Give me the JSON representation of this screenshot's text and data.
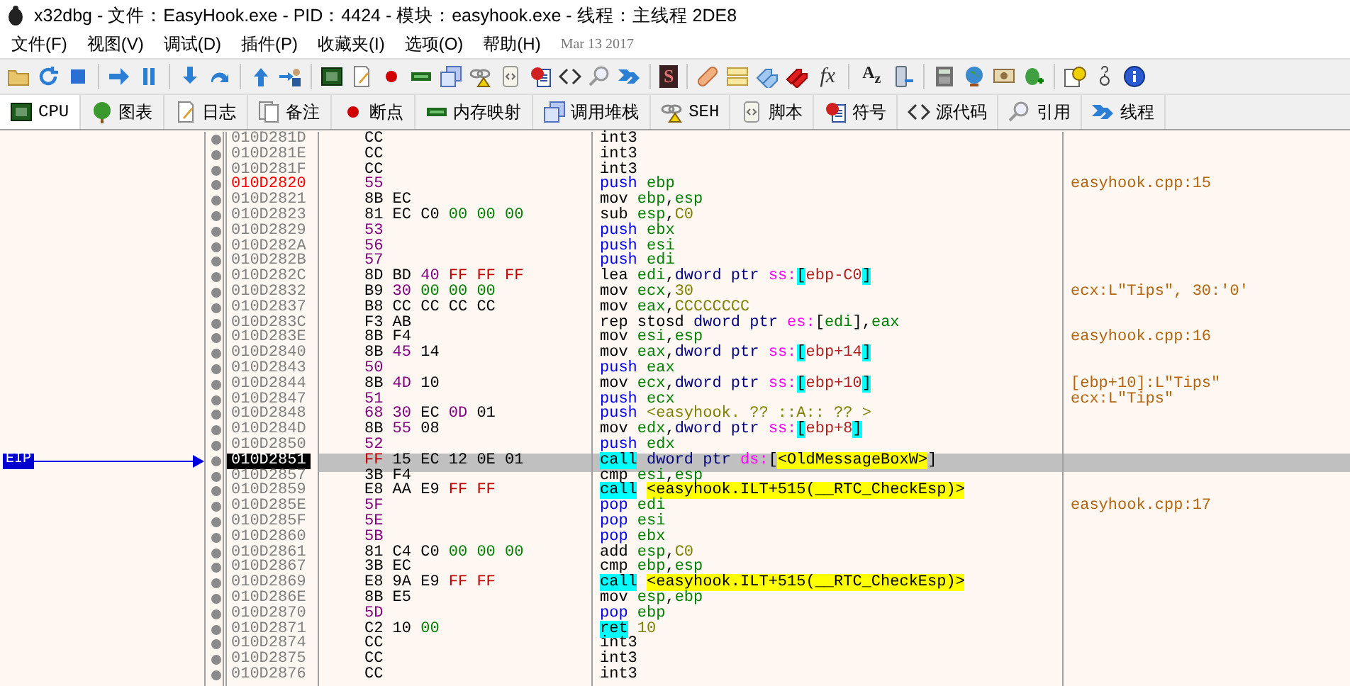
{
  "window": {
    "title": "x32dbg - 文件：EasyHook.exe - PID：4424 - 模块：easyhook.exe - 线程：主线程 2DE8"
  },
  "menu": [
    "文件(F)",
    "视图(V)",
    "调试(D)",
    "插件(P)",
    "收藏夹(I)",
    "选项(O)",
    "帮助(H)"
  ],
  "build_date": "Mar 13 2017",
  "toolbar_labels": [
    "S",
    "fx",
    "A$_{z}$"
  ],
  "tabs": [
    {
      "label": "CPU",
      "selected": true
    },
    {
      "label": "图表",
      "selected": false
    },
    {
      "label": "日志",
      "selected": false
    },
    {
      "label": "备注",
      "selected": false
    },
    {
      "label": "断点",
      "selected": false
    },
    {
      "label": "内存映射",
      "selected": false
    },
    {
      "label": "调用堆栈",
      "selected": false
    },
    {
      "label": "SEH",
      "selected": false
    },
    {
      "label": "脚本",
      "selected": false
    },
    {
      "label": "符号",
      "selected": false
    },
    {
      "label": "源代码",
      "selected": false
    },
    {
      "label": "引用",
      "selected": false
    },
    {
      "label": "线程",
      "selected": false
    }
  ],
  "eip_label": "EIP",
  "rows": [
    {
      "address": "010D281D",
      "kind": "normal",
      "selected": false,
      "bytes": [
        {
          "kind": "k",
          "text": "CC"
        }
      ],
      "instr": [
        {
          "kind": "m",
          "text": "int3"
        }
      ]
    },
    {
      "address": "010D281E",
      "kind": "normal",
      "selected": false,
      "bytes": [
        {
          "kind": "k",
          "text": "CC"
        }
      ],
      "instr": [
        {
          "kind": "m",
          "text": "int3"
        }
      ]
    },
    {
      "address": "010D281F",
      "kind": "normal",
      "selected": false,
      "bytes": [
        {
          "kind": "k",
          "text": "CC"
        }
      ],
      "instr": [
        {
          "kind": "m",
          "text": "int3"
        }
      ]
    },
    {
      "address": "010D2820",
      "kind": "function",
      "selected": false,
      "bytes": [
        {
          "kind": "p",
          "text": "55"
        }
      ],
      "instr": [
        {
          "kind": "mp",
          "text": "push"
        },
        {
          "kind": "r",
          "text": "ebp"
        }
      ],
      "comment": "easyhook.cpp:15"
    },
    {
      "address": "010D2821",
      "kind": "normal",
      "selected": false,
      "bytes": [
        {
          "kind": "k",
          "text": "8B"
        },
        {
          "kind": "k",
          "text": "EC"
        }
      ],
      "instr": [
        {
          "kind": "m",
          "text": "mov"
        },
        {
          "kind": "r",
          "text": "ebp"
        },
        {
          "kind": "t",
          "text": ","
        },
        {
          "kind": "r",
          "text": "esp"
        }
      ]
    },
    {
      "address": "010D2823",
      "kind": "normal",
      "selected": false,
      "bytes": [
        {
          "kind": "k",
          "text": "81"
        },
        {
          "kind": "k",
          "text": "EC"
        },
        {
          "kind": "k",
          "text": "C0"
        },
        {
          "kind": "g",
          "text": "00"
        },
        {
          "kind": "g",
          "text": "00"
        },
        {
          "kind": "g",
          "text": "00"
        }
      ],
      "instr": [
        {
          "kind": "m",
          "text": "sub"
        },
        {
          "kind": "r",
          "text": "esp"
        },
        {
          "kind": "t",
          "text": ","
        },
        {
          "kind": "n",
          "text": "C0"
        }
      ]
    },
    {
      "address": "010D2829",
      "kind": "normal",
      "selected": false,
      "bytes": [
        {
          "kind": "p",
          "text": "53"
        }
      ],
      "instr": [
        {
          "kind": "mp",
          "text": "push"
        },
        {
          "kind": "r",
          "text": "ebx"
        }
      ]
    },
    {
      "address": "010D282A",
      "kind": "normal",
      "selected": false,
      "bytes": [
        {
          "kind": "p",
          "text": "56"
        }
      ],
      "instr": [
        {
          "kind": "mp",
          "text": "push"
        },
        {
          "kind": "r",
          "text": "esi"
        }
      ]
    },
    {
      "address": "010D282B",
      "kind": "normal",
      "selected": false,
      "bytes": [
        {
          "kind": "p",
          "text": "57"
        }
      ],
      "instr": [
        {
          "kind": "mp",
          "text": "push"
        },
        {
          "kind": "r",
          "text": "edi"
        }
      ]
    },
    {
      "address": "010D282C",
      "kind": "normal",
      "selected": false,
      "bytes": [
        {
          "kind": "k",
          "text": "8D"
        },
        {
          "kind": "k",
          "text": "BD"
        },
        {
          "kind": "p",
          "text": "40"
        },
        {
          "kind": "d",
          "text": "FF"
        },
        {
          "kind": "d",
          "text": "FF"
        },
        {
          "kind": "d",
          "text": "FF"
        }
      ],
      "instr": [
        {
          "kind": "m",
          "text": "lea"
        },
        {
          "kind": "r",
          "text": "edi"
        },
        {
          "kind": "t",
          "text": ","
        },
        {
          "kind": "q",
          "text": "dword ptr"
        },
        {
          "kind": "s",
          "text": "ss:"
        },
        {
          "kind": "b",
          "text": "["
        },
        {
          "kind": "a",
          "text": "ebp-C0"
        },
        {
          "kind": "b",
          "text": "]"
        }
      ]
    },
    {
      "address": "010D2832",
      "kind": "normal",
      "selected": false,
      "bytes": [
        {
          "kind": "k",
          "text": "B9"
        },
        {
          "kind": "p",
          "text": "30"
        },
        {
          "kind": "g",
          "text": "00"
        },
        {
          "kind": "g",
          "text": "00"
        },
        {
          "kind": "g",
          "text": "00"
        }
      ],
      "instr": [
        {
          "kind": "m",
          "text": "mov"
        },
        {
          "kind": "r",
          "text": "ecx"
        },
        {
          "kind": "t",
          "text": ","
        },
        {
          "kind": "n",
          "text": "30"
        }
      ],
      "comment": "ecx:L\"Tips\", 30:'0'"
    },
    {
      "address": "010D2837",
      "kind": "normal",
      "selected": false,
      "bytes": [
        {
          "kind": "k",
          "text": "B8"
        },
        {
          "kind": "k",
          "text": "CC"
        },
        {
          "kind": "k",
          "text": "CC"
        },
        {
          "kind": "k",
          "text": "CC"
        },
        {
          "kind": "k",
          "text": "CC"
        }
      ],
      "instr": [
        {
          "kind": "m",
          "text": "mov"
        },
        {
          "kind": "r",
          "text": "eax"
        },
        {
          "kind": "t",
          "text": ","
        },
        {
          "kind": "n",
          "text": "CCCCCCCC"
        }
      ]
    },
    {
      "address": "010D283C",
      "kind": "normal",
      "selected": false,
      "bytes": [
        {
          "kind": "k",
          "text": "F3"
        },
        {
          "kind": "k",
          "text": "AB"
        }
      ],
      "instr": [
        {
          "kind": "m",
          "text": "rep stosd"
        },
        {
          "kind": "q",
          "text": "dword ptr"
        },
        {
          "kind": "s",
          "text": "es:"
        },
        {
          "kind": "t",
          "text": "["
        },
        {
          "kind": "r",
          "text": "edi"
        },
        {
          "kind": "t",
          "text": "],"
        },
        {
          "kind": "r",
          "text": "eax"
        }
      ]
    },
    {
      "address": "010D283E",
      "kind": "normal",
      "selected": false,
      "bytes": [
        {
          "kind": "k",
          "text": "8B"
        },
        {
          "kind": "k",
          "text": "F4"
        }
      ],
      "instr": [
        {
          "kind": "m",
          "text": "mov"
        },
        {
          "kind": "r",
          "text": "esi"
        },
        {
          "kind": "t",
          "text": ","
        },
        {
          "kind": "r",
          "text": "esp"
        }
      ],
      "comment": "easyhook.cpp:16"
    },
    {
      "address": "010D2840",
      "kind": "normal",
      "selected": false,
      "bytes": [
        {
          "kind": "k",
          "text": "8B"
        },
        {
          "kind": "p",
          "text": "45"
        },
        {
          "kind": "k",
          "text": "14"
        }
      ],
      "instr": [
        {
          "kind": "m",
          "text": "mov"
        },
        {
          "kind": "r",
          "text": "eax"
        },
        {
          "kind": "t",
          "text": ","
        },
        {
          "kind": "q",
          "text": "dword ptr"
        },
        {
          "kind": "s",
          "text": "ss:"
        },
        {
          "kind": "b",
          "text": "["
        },
        {
          "kind": "a",
          "text": "ebp+14"
        },
        {
          "kind": "b",
          "text": "]"
        }
      ]
    },
    {
      "address": "010D2843",
      "kind": "normal",
      "selected": false,
      "bytes": [
        {
          "kind": "p",
          "text": "50"
        }
      ],
      "instr": [
        {
          "kind": "mp",
          "text": "push"
        },
        {
          "kind": "r",
          "text": "eax"
        }
      ]
    },
    {
      "address": "010D2844",
      "kind": "normal",
      "selected": false,
      "bytes": [
        {
          "kind": "k",
          "text": "8B"
        },
        {
          "kind": "p",
          "text": "4D"
        },
        {
          "kind": "k",
          "text": "10"
        }
      ],
      "instr": [
        {
          "kind": "m",
          "text": "mov"
        },
        {
          "kind": "r",
          "text": "ecx"
        },
        {
          "kind": "t",
          "text": ","
        },
        {
          "kind": "q",
          "text": "dword ptr"
        },
        {
          "kind": "s",
          "text": "ss:"
        },
        {
          "kind": "b",
          "text": "["
        },
        {
          "kind": "a",
          "text": "ebp+10"
        },
        {
          "kind": "b",
          "text": "]"
        }
      ],
      "comment": "[ebp+10]:L\"Tips\""
    },
    {
      "address": "010D2847",
      "kind": "normal",
      "selected": false,
      "bytes": [
        {
          "kind": "p",
          "text": "51"
        }
      ],
      "instr": [
        {
          "kind": "mp",
          "text": "push"
        },
        {
          "kind": "r",
          "text": "ecx"
        }
      ],
      "comment": "ecx:L\"Tips\""
    },
    {
      "address": "010D2848",
      "kind": "normal",
      "selected": false,
      "bytes": [
        {
          "kind": "p",
          "text": "68"
        },
        {
          "kind": "p",
          "text": "30"
        },
        {
          "kind": "k",
          "text": "EC"
        },
        {
          "kind": "p",
          "text": "0D"
        },
        {
          "kind": "k",
          "text": "01"
        }
      ],
      "instr": [
        {
          "kind": "mp",
          "text": "push"
        },
        {
          "kind": "o",
          "text": "<easyhook. ?? ::A:: ?? >"
        }
      ]
    },
    {
      "address": "010D284D",
      "kind": "normal",
      "selected": false,
      "bytes": [
        {
          "kind": "k",
          "text": "8B"
        },
        {
          "kind": "p",
          "text": "55"
        },
        {
          "kind": "k",
          "text": "08"
        }
      ],
      "instr": [
        {
          "kind": "m",
          "text": "mov"
        },
        {
          "kind": "r",
          "text": "edx"
        },
        {
          "kind": "t",
          "text": ","
        },
        {
          "kind": "q",
          "text": "dword ptr"
        },
        {
          "kind": "s",
          "text": "ss:"
        },
        {
          "kind": "b",
          "text": "["
        },
        {
          "kind": "a",
          "text": "ebp+8"
        },
        {
          "kind": "b",
          "text": "]"
        }
      ]
    },
    {
      "address": "010D2850",
      "kind": "normal",
      "selected": false,
      "bytes": [
        {
          "kind": "p",
          "text": "52"
        }
      ],
      "instr": [
        {
          "kind": "mp",
          "text": "push"
        },
        {
          "kind": "r",
          "text": "edx"
        }
      ]
    },
    {
      "address": "010D2851",
      "kind": "eip",
      "selected": true,
      "bytes": [
        {
          "kind": "d",
          "text": "FF"
        },
        {
          "kind": "k",
          "text": "15"
        },
        {
          "kind": "k",
          "text": "EC"
        },
        {
          "kind": "k",
          "text": "12"
        },
        {
          "kind": "k",
          "text": "0E"
        },
        {
          "kind": "k",
          "text": "01"
        }
      ],
      "instr": [
        {
          "kind": "mc",
          "text": "call"
        },
        {
          "kind": "q",
          "text": "dword ptr"
        },
        {
          "kind": "s",
          "text": "ds:"
        },
        {
          "kind": "t",
          "text": "["
        },
        {
          "kind": "l",
          "text": "<OldMessageBoxW>"
        },
        {
          "kind": "t",
          "text": "]"
        }
      ]
    },
    {
      "address": "010D2857",
      "kind": "normal",
      "selected": false,
      "bytes": [
        {
          "kind": "k",
          "text": "3B"
        },
        {
          "kind": "k",
          "text": "F4"
        }
      ],
      "instr": [
        {
          "kind": "m",
          "text": "cmp"
        },
        {
          "kind": "r",
          "text": "esi"
        },
        {
          "kind": "t",
          "text": ","
        },
        {
          "kind": "r",
          "text": "esp"
        }
      ]
    },
    {
      "address": "010D2859",
      "kind": "normal",
      "selected": false,
      "bytes": [
        {
          "kind": "k",
          "text": "E8"
        },
        {
          "kind": "k",
          "text": "AA"
        },
        {
          "kind": "k",
          "text": "E9"
        },
        {
          "kind": "d",
          "text": "FF"
        },
        {
          "kind": "d",
          "text": "FF"
        }
      ],
      "instr": [
        {
          "kind": "mc",
          "text": "call"
        },
        {
          "kind": "l",
          "text": "<easyhook.ILT+515(__RTC_CheckEsp)>"
        }
      ]
    },
    {
      "address": "010D285E",
      "kind": "normal",
      "selected": false,
      "bytes": [
        {
          "kind": "p",
          "text": "5F"
        }
      ],
      "instr": [
        {
          "kind": "mp",
          "text": "pop"
        },
        {
          "kind": "r",
          "text": "edi"
        }
      ],
      "comment": "easyhook.cpp:17"
    },
    {
      "address": "010D285F",
      "kind": "normal",
      "selected": false,
      "bytes": [
        {
          "kind": "p",
          "text": "5E"
        }
      ],
      "instr": [
        {
          "kind": "mp",
          "text": "pop"
        },
        {
          "kind": "r",
          "text": "esi"
        }
      ]
    },
    {
      "address": "010D2860",
      "kind": "normal",
      "selected": false,
      "bytes": [
        {
          "kind": "p",
          "text": "5B"
        }
      ],
      "instr": [
        {
          "kind": "mp",
          "text": "pop"
        },
        {
          "kind": "r",
          "text": "ebx"
        }
      ]
    },
    {
      "address": "010D2861",
      "kind": "normal",
      "selected": false,
      "bytes": [
        {
          "kind": "k",
          "text": "81"
        },
        {
          "kind": "k",
          "text": "C4"
        },
        {
          "kind": "k",
          "text": "C0"
        },
        {
          "kind": "g",
          "text": "00"
        },
        {
          "kind": "g",
          "text": "00"
        },
        {
          "kind": "g",
          "text": "00"
        }
      ],
      "instr": [
        {
          "kind": "m",
          "text": "add"
        },
        {
          "kind": "r",
          "text": "esp"
        },
        {
          "kind": "t",
          "text": ","
        },
        {
          "kind": "n",
          "text": "C0"
        }
      ]
    },
    {
      "address": "010D2867",
      "kind": "normal",
      "selected": false,
      "bytes": [
        {
          "kind": "k",
          "text": "3B"
        },
        {
          "kind": "k",
          "text": "EC"
        }
      ],
      "instr": [
        {
          "kind": "m",
          "text": "cmp"
        },
        {
          "kind": "r",
          "text": "ebp"
        },
        {
          "kind": "t",
          "text": ","
        },
        {
          "kind": "r",
          "text": "esp"
        }
      ]
    },
    {
      "address": "010D2869",
      "kind": "normal",
      "selected": false,
      "bytes": [
        {
          "kind": "k",
          "text": "E8"
        },
        {
          "kind": "k",
          "text": "9A"
        },
        {
          "kind": "k",
          "text": "E9"
        },
        {
          "kind": "d",
          "text": "FF"
        },
        {
          "kind": "d",
          "text": "FF"
        }
      ],
      "instr": [
        {
          "kind": "mc",
          "text": "call"
        },
        {
          "kind": "l",
          "text": "<easyhook.ILT+515(__RTC_CheckEsp)>"
        }
      ]
    },
    {
      "address": "010D286E",
      "kind": "normal",
      "selected": false,
      "bytes": [
        {
          "kind": "k",
          "text": "8B"
        },
        {
          "kind": "k",
          "text": "E5"
        }
      ],
      "instr": [
        {
          "kind": "m",
          "text": "mov"
        },
        {
          "kind": "r",
          "text": "esp"
        },
        {
          "kind": "t",
          "text": ","
        },
        {
          "kind": "r",
          "text": "ebp"
        }
      ]
    },
    {
      "address": "010D2870",
      "kind": "normal",
      "selected": false,
      "bytes": [
        {
          "kind": "p",
          "text": "5D"
        }
      ],
      "instr": [
        {
          "kind": "mp",
          "text": "pop"
        },
        {
          "kind": "r",
          "text": "ebp"
        }
      ]
    },
    {
      "address": "010D2871",
      "kind": "normal",
      "selected": false,
      "bytes": [
        {
          "kind": "k",
          "text": "C2"
        },
        {
          "kind": "k",
          "text": "10"
        },
        {
          "kind": "g",
          "text": "00"
        }
      ],
      "instr": [
        {
          "kind": "mc",
          "text": "ret"
        },
        {
          "kind": "n",
          "text": "10"
        }
      ]
    },
    {
      "address": "010D2874",
      "kind": "normal",
      "selected": false,
      "bytes": [
        {
          "kind": "k",
          "text": "CC"
        }
      ],
      "instr": [
        {
          "kind": "m",
          "text": "int3"
        }
      ]
    },
    {
      "address": "010D2875",
      "kind": "normal",
      "selected": false,
      "bytes": [
        {
          "kind": "k",
          "text": "CC"
        }
      ],
      "instr": [
        {
          "kind": "m",
          "text": "int3"
        }
      ]
    },
    {
      "address": "010D2876",
      "kind": "normal",
      "selected": false,
      "bytes": [
        {
          "kind": "k",
          "text": "CC"
        }
      ],
      "instr": [
        {
          "kind": "m",
          "text": "int3"
        }
      ]
    }
  ]
}
